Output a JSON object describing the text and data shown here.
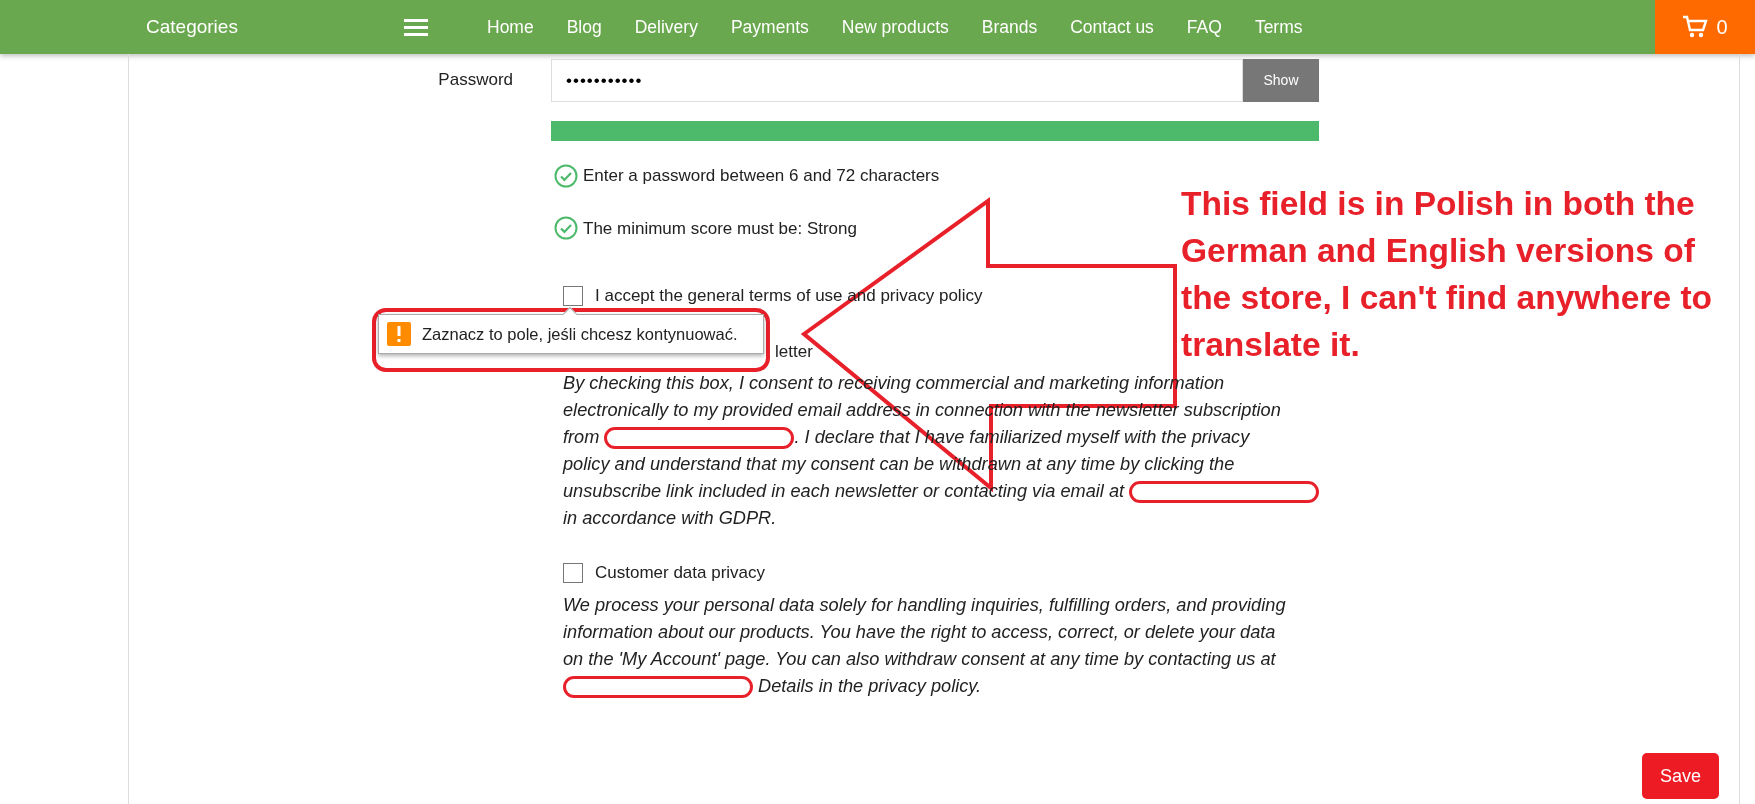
{
  "nav": {
    "categories": "Categories",
    "links": [
      "Home",
      "Blog",
      "Delivery",
      "Payments",
      "New products",
      "Brands",
      "Contact us",
      "FAQ",
      "Terms"
    ],
    "cart_count": "0"
  },
  "password": {
    "label": "Password",
    "value": "•••••••••••",
    "show_button": "Show",
    "strength": {
      "level": 1
    }
  },
  "rules": [
    {
      "text": "Enter a password between 6 and 72 characters",
      "met": true
    },
    {
      "text": "The minimum score must be: Strong",
      "met": true
    }
  ],
  "consents": [
    {
      "kind": "checkbox",
      "label": "I accept the general terms of use and privacy policy",
      "checked": false
    },
    {
      "kind": "covered",
      "label": "letter",
      "lines": [
        [
          {
            "kind": "text",
            "text": "By checking this box, I consent to receiving commercial and marketing information"
          }
        ],
        [
          {
            "kind": "text",
            "text": "electronically to my provided email address in connection with the newsletter subscription"
          }
        ],
        [
          {
            "kind": "text",
            "text": "from "
          },
          {
            "kind": "redaction"
          },
          {
            "kind": "text",
            "text": ". I declare that I have familiarized myself with the privacy"
          }
        ],
        [
          {
            "kind": "text",
            "text": "policy and understand that my consent can be withdrawn at any time by clicking the"
          }
        ],
        [
          {
            "kind": "text",
            "text": "unsubscribe link included in each newsletter or contacting via email at "
          },
          {
            "kind": "redaction"
          }
        ],
        [
          {
            "kind": "text",
            "text": "in accordance with GDPR."
          }
        ]
      ]
    },
    {
      "kind": "checkbox",
      "label": "Customer data privacy",
      "checked": false,
      "lines": [
        [
          {
            "kind": "text",
            "text": "We process your personal data solely for handling inquiries, fulfilling orders, and providing"
          }
        ],
        [
          {
            "kind": "text",
            "text": "information about our products. You have the right to access, correct, or delete your data"
          }
        ],
        [
          {
            "kind": "text",
            "text": "on the 'My Account' page. You can also withdraw consent at any time by contacting us at"
          }
        ],
        [
          {
            "kind": "redaction"
          },
          {
            "kind": "text",
            "text": " Details in the privacy policy."
          }
        ]
      ]
    }
  ],
  "tooltip": {
    "text": "Zaznacz to pole, jeśli chcesz kontynuować."
  },
  "annotation": {
    "text": "This field is in Polish in both the German and English versions of the store, I can't find anywhere to translate it."
  },
  "save_button": "Save"
}
